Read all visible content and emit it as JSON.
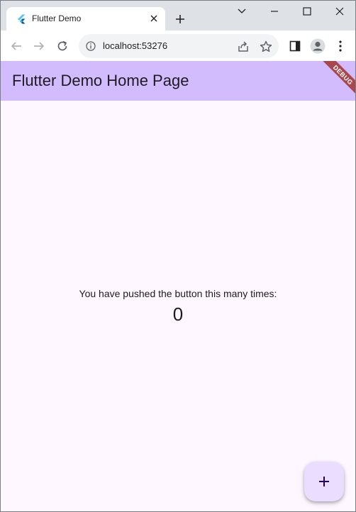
{
  "browser": {
    "tab": {
      "title": "Flutter Demo",
      "favicon": "flutter-logo-icon",
      "close_icon": "close-icon"
    },
    "new_tab_icon": "plus-icon",
    "window_controls": [
      "chevron-down-icon",
      "minimize-icon",
      "maximize-icon",
      "close-icon"
    ],
    "toolbar": {
      "back_icon": "arrow-left-icon",
      "forward_icon": "arrow-right-icon",
      "reload_icon": "reload-icon",
      "address": "localhost:53276",
      "site_info_icon": "info-icon",
      "share_icon": "share-icon",
      "bookmark_icon": "star-icon",
      "side_panel_icon": "side-panel-icon",
      "profile_icon": "avatar-icon",
      "menu_icon": "kebab-menu-icon"
    }
  },
  "app": {
    "appbar_title": "Flutter Demo Home Page",
    "debug_banner": "DEBUG",
    "message": "You have pushed the button this many times:",
    "counter": "0",
    "fab_icon": "plus-icon"
  },
  "colors": {
    "appbar": "#d3bcfd",
    "background": "#fef7ff",
    "fab": "#eaddff",
    "debug_banner": "#a8484d",
    "tabstrip": "#dee1e6"
  }
}
